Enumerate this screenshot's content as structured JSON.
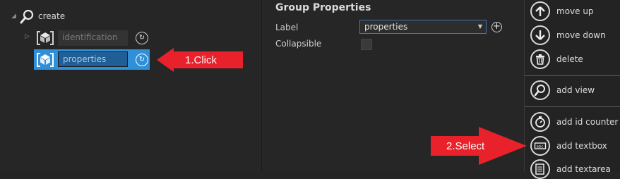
{
  "tree": {
    "root": {
      "label": "create",
      "icon": "search-icon"
    },
    "nodes": [
      {
        "name": "identification",
        "icon": "cube-icon",
        "action_icon": "refresh-icon",
        "selected": false
      },
      {
        "name": "properties",
        "icon": "cube-icon",
        "action_icon": "refresh-icon",
        "selected": true
      }
    ]
  },
  "properties_panel": {
    "title": "Group Properties",
    "label_field": {
      "label": "Label",
      "value": "properties"
    },
    "collapsible_field": {
      "label": "Collapsible",
      "checked": false
    }
  },
  "toolbar": {
    "items": [
      {
        "label": "move up",
        "icon": "arrow-up-icon"
      },
      {
        "label": "move down",
        "icon": "arrow-down-icon"
      },
      {
        "label": "delete",
        "icon": "trash-icon"
      },
      {
        "label": "add view",
        "icon": "search-icon"
      },
      {
        "label": "add id counter",
        "icon": "counter-icon"
      },
      {
        "label": "add textbox",
        "icon": "textbox-icon"
      },
      {
        "label": "add textarea",
        "icon": "textarea-icon"
      }
    ]
  },
  "annotations": {
    "step1": "1.Click",
    "step2": "2.Select",
    "color": "#e8212b"
  },
  "colors": {
    "selection": "#2f8fd8",
    "accent_border": "#3c78b7"
  }
}
